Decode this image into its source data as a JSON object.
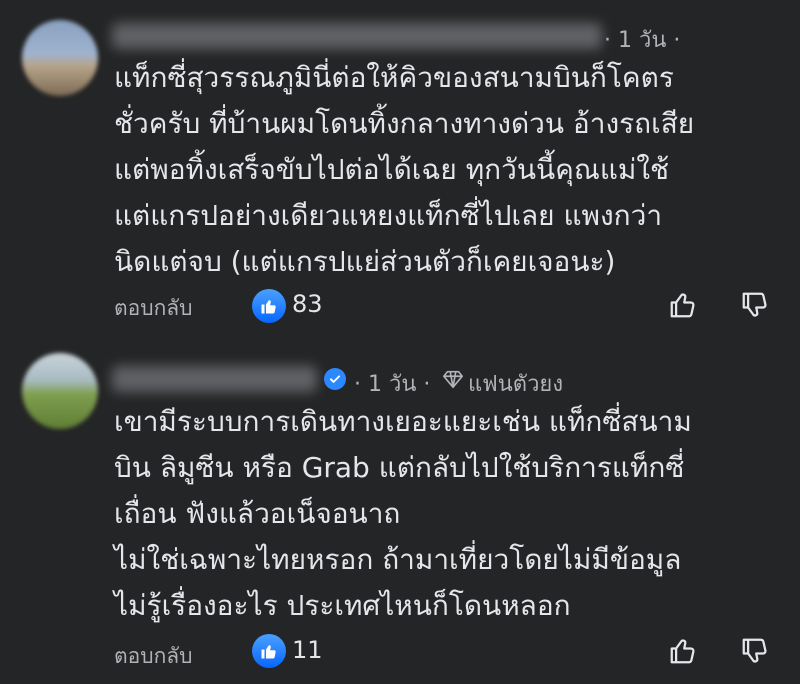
{
  "comments": [
    {
      "author_hidden": true,
      "time": "· 1 วัน ·",
      "text": "แท็กซี่สุวรรณภูมินี่ต่อให้คิวของสนามบินก็โคตร\nชั่วครับ ที่บ้านผมโดนทิ้งกลางทางด่วน อ้างรถเสีย\nแต่พอทิ้งเสร็จขับไปต่อได้เฉย ทุกวันนี้คุณแม่ใช้\nแต่แกรปอย่างเดียวแหยงแท็กซี่ไปเลย แพงกว่า\nนิดแต่จบ (แต่แกรปแย่ส่วนตัวก็เคยเจอนะ)",
      "reply_label": "ตอบกลับ",
      "like_count": "83"
    },
    {
      "author_hidden": true,
      "time": "· 1 วัน ·",
      "badge": "แฟนตัวยง",
      "text": "เขามีระบบการเดินทางเยอะแยะเช่น แท็กซี่สนาม\nบิน ลิมูซีน หรือ Grab แต่กลับไปใช้บริการแท็กซี่\nเถื่อน ฟังแล้วอเน็จอนาถ\nไม่ใช่เฉพาะไทยหรอก ถ้ามาเที่ยวโดยไม่มีข้อมูล\nไม่รู้เรื่องอะไร ประเทศไหนก็โดนหลอก",
      "reply_label": "ตอบกลับ",
      "like_count": "11"
    }
  ],
  "colors": {
    "background": "#242526",
    "text": "#e4e6eb",
    "secondary": "#b0b3b8",
    "like_blue": "#0866ff",
    "verified_blue": "#2d88ff"
  },
  "icons": [
    "like-badge-icon",
    "thumbs-up-icon",
    "thumbs-down-icon",
    "verified-icon",
    "diamond-icon"
  ]
}
